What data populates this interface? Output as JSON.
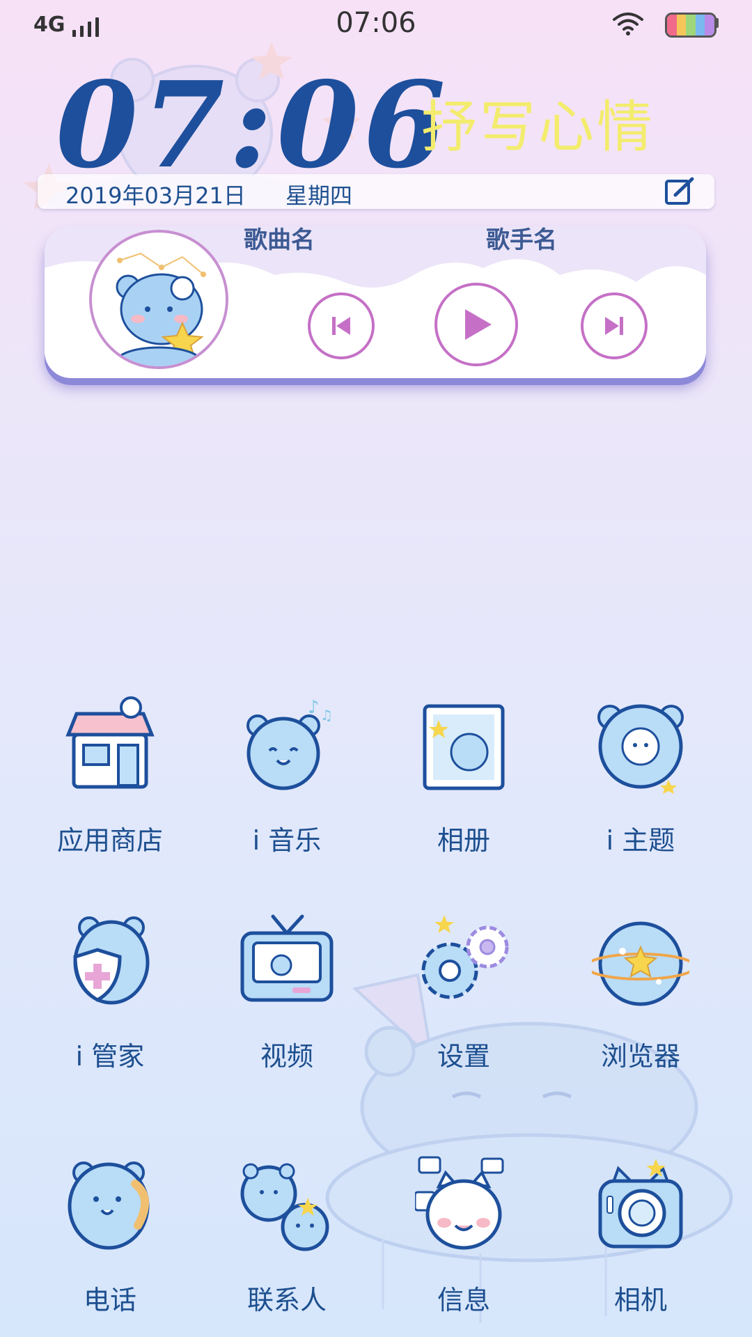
{
  "status_bar": {
    "network": "4G",
    "time": "07:06",
    "battery_colors": [
      "#f06a8a",
      "#f5c75a",
      "#9fd67a",
      "#79b9f0",
      "#b78be6"
    ]
  },
  "widget": {
    "big_time": "07:06",
    "mood_text": "抒写心情",
    "date": "2019年03月21日",
    "weekday": "星期四",
    "edit_icon": "edit-icon"
  },
  "music": {
    "song_name": "歌曲名",
    "artist_name": "歌手名",
    "controls": [
      "previous-icon",
      "play-icon",
      "next-icon"
    ]
  },
  "apps": [
    {
      "label": "应用商店",
      "icon": "app-store-icon"
    },
    {
      "label": "i 音乐",
      "icon": "music-bear-icon"
    },
    {
      "label": "相册",
      "icon": "album-frame-icon"
    },
    {
      "label": "i 主题",
      "icon": "theme-bear-icon"
    },
    {
      "label": "i 管家",
      "icon": "shield-bear-icon"
    },
    {
      "label": "视频",
      "icon": "tv-icon"
    },
    {
      "label": "设置",
      "icon": "gears-icon"
    },
    {
      "label": "浏览器",
      "icon": "planet-icon"
    },
    {
      "label": "电话",
      "icon": "phone-bear-icon"
    },
    {
      "label": "联系人",
      "icon": "contacts-bears-icon"
    },
    {
      "label": "信息",
      "icon": "message-cat-icon"
    },
    {
      "label": "相机",
      "icon": "camera-icon"
    }
  ],
  "colors": {
    "accent_blue": "#1d4f9c",
    "mood_yellow": "#f3ec6d",
    "control_purple": "#c570c6",
    "icon_fill": "#b9dcf7"
  }
}
